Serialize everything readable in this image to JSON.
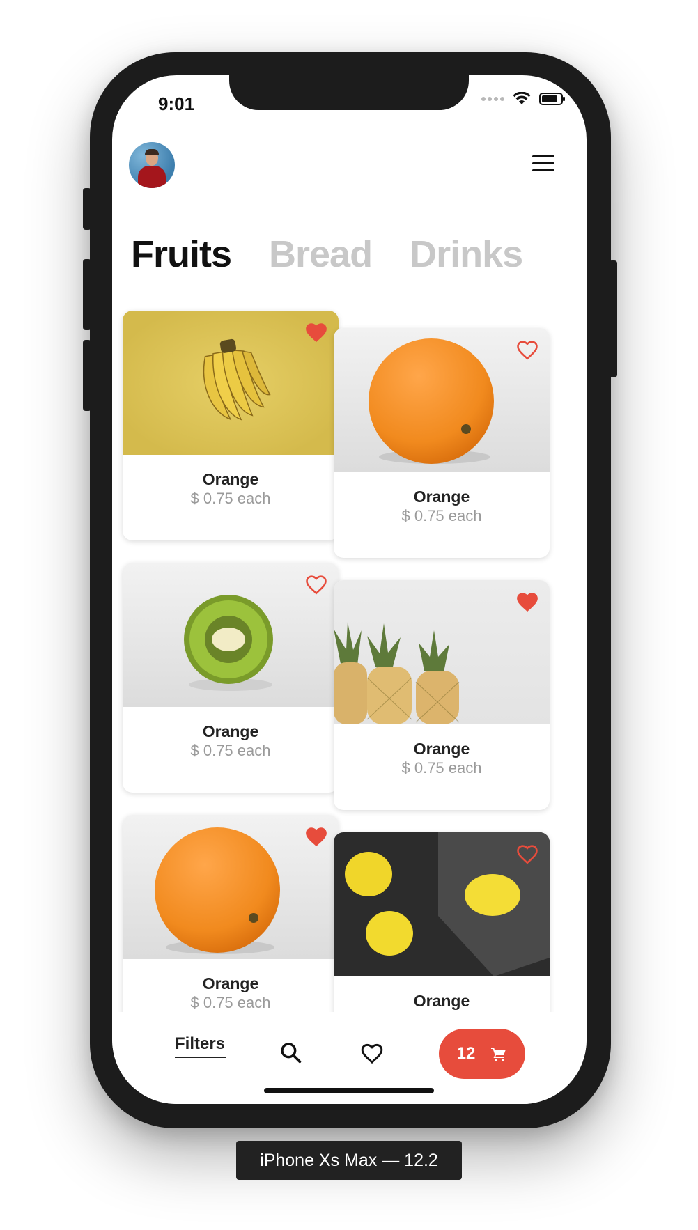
{
  "status_bar": {
    "time": "9:01"
  },
  "header": {
    "avatar_icon": "user-avatar",
    "menu_icon": "hamburger-menu-icon"
  },
  "tabs": [
    {
      "label": "Fruits",
      "active": true
    },
    {
      "label": "Bread",
      "active": false
    },
    {
      "label": "Drinks",
      "active": false
    }
  ],
  "products": [
    {
      "name": "Orange",
      "price": "$ 0.75 each",
      "image": "bananas",
      "favorite": true
    },
    {
      "name": "Orange",
      "price": "$ 0.75 each",
      "image": "orange",
      "favorite": false
    },
    {
      "name": "Orange",
      "price": "$ 0.75 each",
      "image": "kiwi",
      "favorite": false
    },
    {
      "name": "Orange",
      "price": "$ 0.75 each",
      "image": "pineapples",
      "favorite": true
    },
    {
      "name": "Orange",
      "price": "$ 0.75 each",
      "image": "orange",
      "favorite": true
    },
    {
      "name": "Orange",
      "price": "",
      "image": "lemons",
      "favorite": false
    }
  ],
  "bottom_bar": {
    "filters_label": "Filters",
    "search_icon": "search-icon",
    "favorites_icon": "heart-outline-icon",
    "cart_count": "12",
    "cart_icon": "shopping-cart-icon"
  },
  "colors": {
    "accent": "#e74c3c",
    "active_tab": "#111111",
    "inactive_tab": "#c8c8c8",
    "price_text": "#9a9a9a"
  },
  "device_label": "iPhone Xs Max — 12.2"
}
